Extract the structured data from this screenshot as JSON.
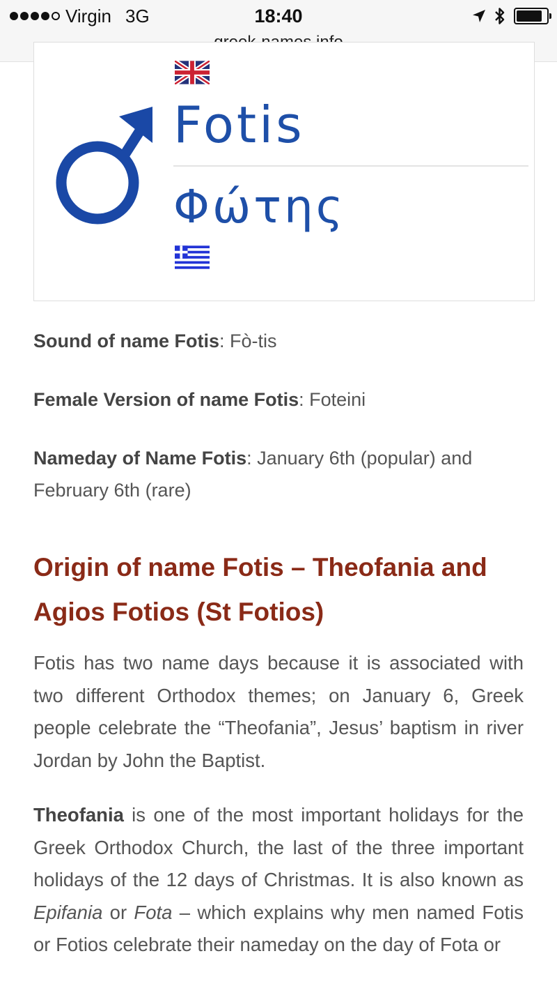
{
  "status_bar": {
    "carrier": "Virgin",
    "network": "3G",
    "time": "18:40",
    "signal_bars": 4,
    "signal_total": 5,
    "icons": [
      "location-arrow-icon",
      "bluetooth-icon",
      "battery-icon"
    ],
    "battery_level": 0.85
  },
  "url": "greek-names.info",
  "name_card": {
    "gender_icon": "male-symbol-icon",
    "flag_top": "uk-flag-icon",
    "flag_bottom": "greek-flag-icon",
    "name_latin": "Fotis",
    "name_greek": "Φώτης",
    "accent_color": "#1e4fa8"
  },
  "info": {
    "sound_label": "Sound of name Fotis",
    "sound_value": ": Fò-tis",
    "female_label": "Female Version of name Fotis",
    "female_value": ": Foteini",
    "nameday_label": "Nameday of Name Fotis",
    "nameday_value": ": January 6th (popular) and February 6th (rare)"
  },
  "origin": {
    "heading": "Origin of name Fotis – Theofania and Agios Fotios (St Fotios)",
    "heading_color": "#8a2a17",
    "para1": "Fotis has two name days because it is associated with two different Orthodox themes; on January 6, Greek people celebrate the “Theofania”, Jesus’ baptism in river Jordan by John the Baptist.",
    "para2_bold": "Theofania",
    "para2_a": " is one of the most important holidays for the Greek Orthodox Church, the last of the three important holidays of the 12 days of Christmas. It is also known as ",
    "para2_em1": "Epifania",
    "para2_b": " or ",
    "para2_em2": "Fota",
    "para2_c": " – which explains why men named Fotis or Fotios celebrate their nameday on the day of Fota or"
  }
}
